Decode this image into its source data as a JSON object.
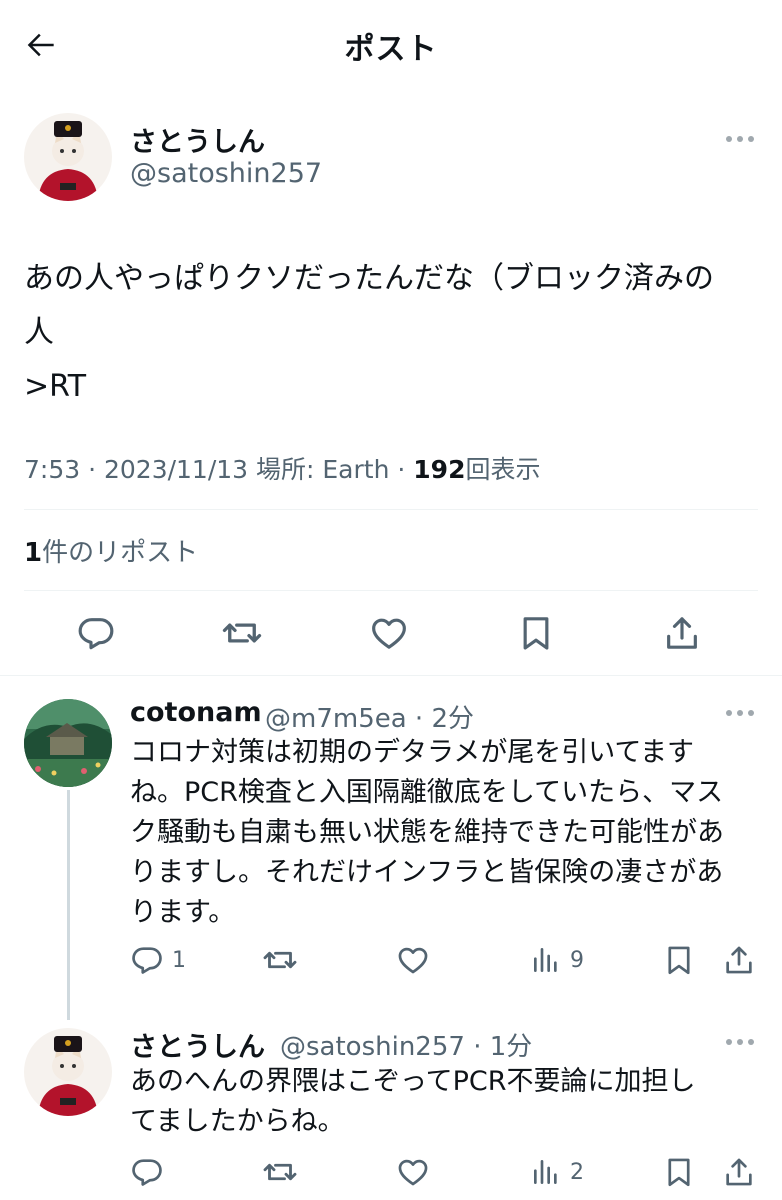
{
  "header": {
    "title": "ポスト"
  },
  "main_post": {
    "display_name": "さとうしん",
    "handle": "@satoshin257",
    "text_lines": [
      "あの人やっぱりクソだったんだな（ブロック済みの",
      "人",
      ">RT"
    ],
    "time": "7:53 · 2023/11/13 場所: Earth · ",
    "views_count": "192",
    "views_label": "回表示",
    "reposts_count": "1",
    "reposts_label": "件のリポスト"
  },
  "replies": [
    {
      "display_name": "cotonam",
      "handle_time": "@m7m5ea · 2分",
      "text_lines": [
        "コロナ対策は初期のデタラメが尾を引いてます",
        "ね。PCR検査と入国隔離徹底をしていたら、マス",
        "ク騒動も自粛も無い状態を維持できた可能性があ",
        "りますし。それだけインフラと皆保険の凄さがあ",
        "ります。"
      ],
      "reply_count": "1",
      "views_count": "9"
    },
    {
      "display_name": "さとうしん",
      "handle_time": "@satoshin257 · 1分",
      "text_lines": [
        "あのへんの界隈はこぞってPCR不要論に加担し",
        "てましたからね。"
      ],
      "reply_count": "",
      "views_count": "2"
    }
  ],
  "icons": {
    "back": "arrow-left-icon",
    "more": "more-dots-icon",
    "reply": "speech-bubble-icon",
    "repost": "repost-arrows-icon",
    "like": "heart-icon",
    "bookmark": "bookmark-icon",
    "share": "share-upload-icon",
    "views": "bar-chart-icon"
  },
  "colors": {
    "text": "#0f1419",
    "secondary": "#536471",
    "divider": "#eff3f4"
  }
}
